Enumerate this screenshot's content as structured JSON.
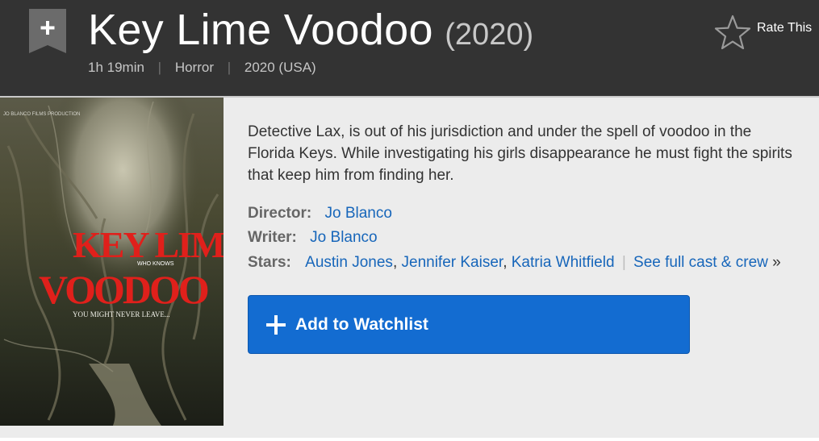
{
  "title": {
    "name": "Key Lime Voodoo",
    "year": "(2020)"
  },
  "subtext": {
    "runtime": "1h 19min",
    "genre": "Horror",
    "release": "2020 (USA)"
  },
  "rate": {
    "label": "Rate This"
  },
  "poster": {
    "studio_text": "JO BLANCO FILMS PRODUCTION",
    "title_line1": "KEY LIME",
    "title_line2": "VOODOO",
    "tagline_small": "WHO KNOWS",
    "tagline": "YOU MIGHT NEVER LEAVE..."
  },
  "plot": "Detective Lax, is out of his jurisdiction and under the spell of voodoo in the Florida Keys. While investigating his girls disappearance he must fight the spirits that keep him from finding her.",
  "credits": {
    "director_label": "Director:",
    "director": "Jo Blanco",
    "writer_label": "Writer:",
    "writer": "Jo Blanco",
    "stars_label": "Stars:",
    "stars": [
      "Austin Jones",
      "Jennifer Kaiser",
      "Katria Whitfield"
    ],
    "full_cast": "See full cast & crew",
    "raquo": "»"
  },
  "watchlist": {
    "label": "Add to Watchlist"
  },
  "colors": {
    "header_bg": "#333333",
    "link": "#1766ba",
    "button": "#136cd1"
  }
}
